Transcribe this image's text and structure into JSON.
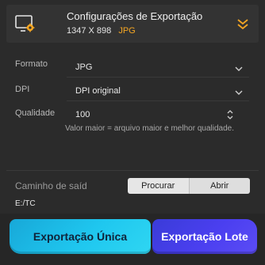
{
  "header": {
    "title": "Configurações de Exportação",
    "dimensions": "1347 X 898",
    "format": "JPG",
    "icon": "monitor-gear-icon",
    "collapse_icon": "double-chevron-down-icon",
    "accent_color": "#f5a623"
  },
  "form": {
    "format": {
      "label": "Formato",
      "value": "JPG"
    },
    "dpi": {
      "label": "DPI",
      "value": "DPI original"
    },
    "quality": {
      "label": "Qualidade",
      "value": "100"
    },
    "hint": "Valor maior = arquivo maior e melhor qualidade."
  },
  "output": {
    "label": "Caminho de saíd",
    "browse_label": "Procurar",
    "open_label": "Abrir",
    "path": "E:/TC"
  },
  "actions": {
    "single_label": "Exportação Única",
    "batch_label": "Exportação Lote",
    "single_color": "#1fc7ef",
    "batch_color": "#4b3ff0"
  }
}
